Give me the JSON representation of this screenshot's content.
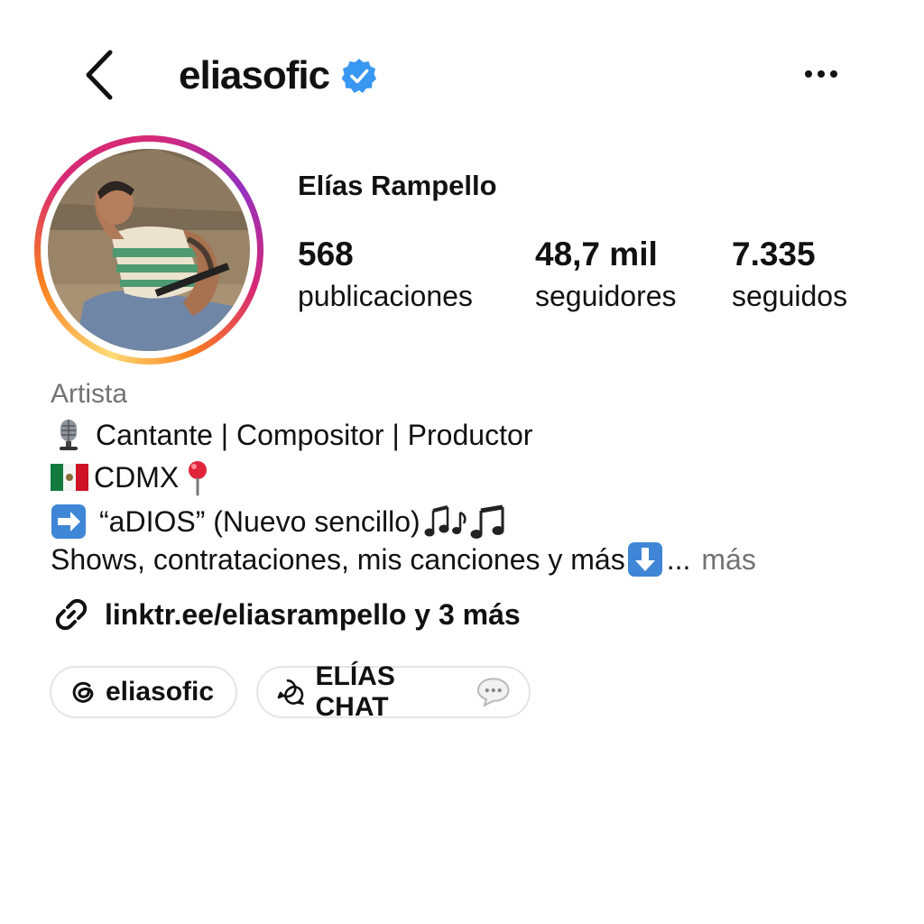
{
  "header": {
    "username": "eliasofic",
    "verified": true,
    "accent_verified": "#3897f0"
  },
  "profile": {
    "full_name": "Elías Rampello",
    "stats": [
      {
        "value": "568",
        "label": "publicaciones"
      },
      {
        "value": "48,7 mil",
        "label": "seguidores"
      },
      {
        "value": "7.335",
        "label": "seguidos"
      }
    ]
  },
  "bio": {
    "category": "Artista",
    "line1": "Cantante | Compositor | Productor",
    "line2": "CDMX",
    "line3": "“aDIOS” (Nuevo sencillo)",
    "line4": "Shows, contrataciones, mis canciones y más",
    "ellipsis": "...",
    "more_label": "más"
  },
  "link": {
    "text": "linktr.ee/eliasrampello y 3 más",
    "icon": "link-icon"
  },
  "chips": [
    {
      "label": "eliasofic",
      "icon": "threads-icon"
    },
    {
      "label": "ELÍAS CHAT",
      "icon": "chat-icon"
    }
  ],
  "icons": {
    "back": "back-arrow-icon",
    "more": "more-options-icon",
    "microphone": "microphone-icon",
    "flag": "mexico-flag-icon",
    "pin": "pin-icon",
    "arrow_right": "arrow-right-icon",
    "notes": "music-notes-icon",
    "arrow_down": "arrow-down-icon"
  }
}
